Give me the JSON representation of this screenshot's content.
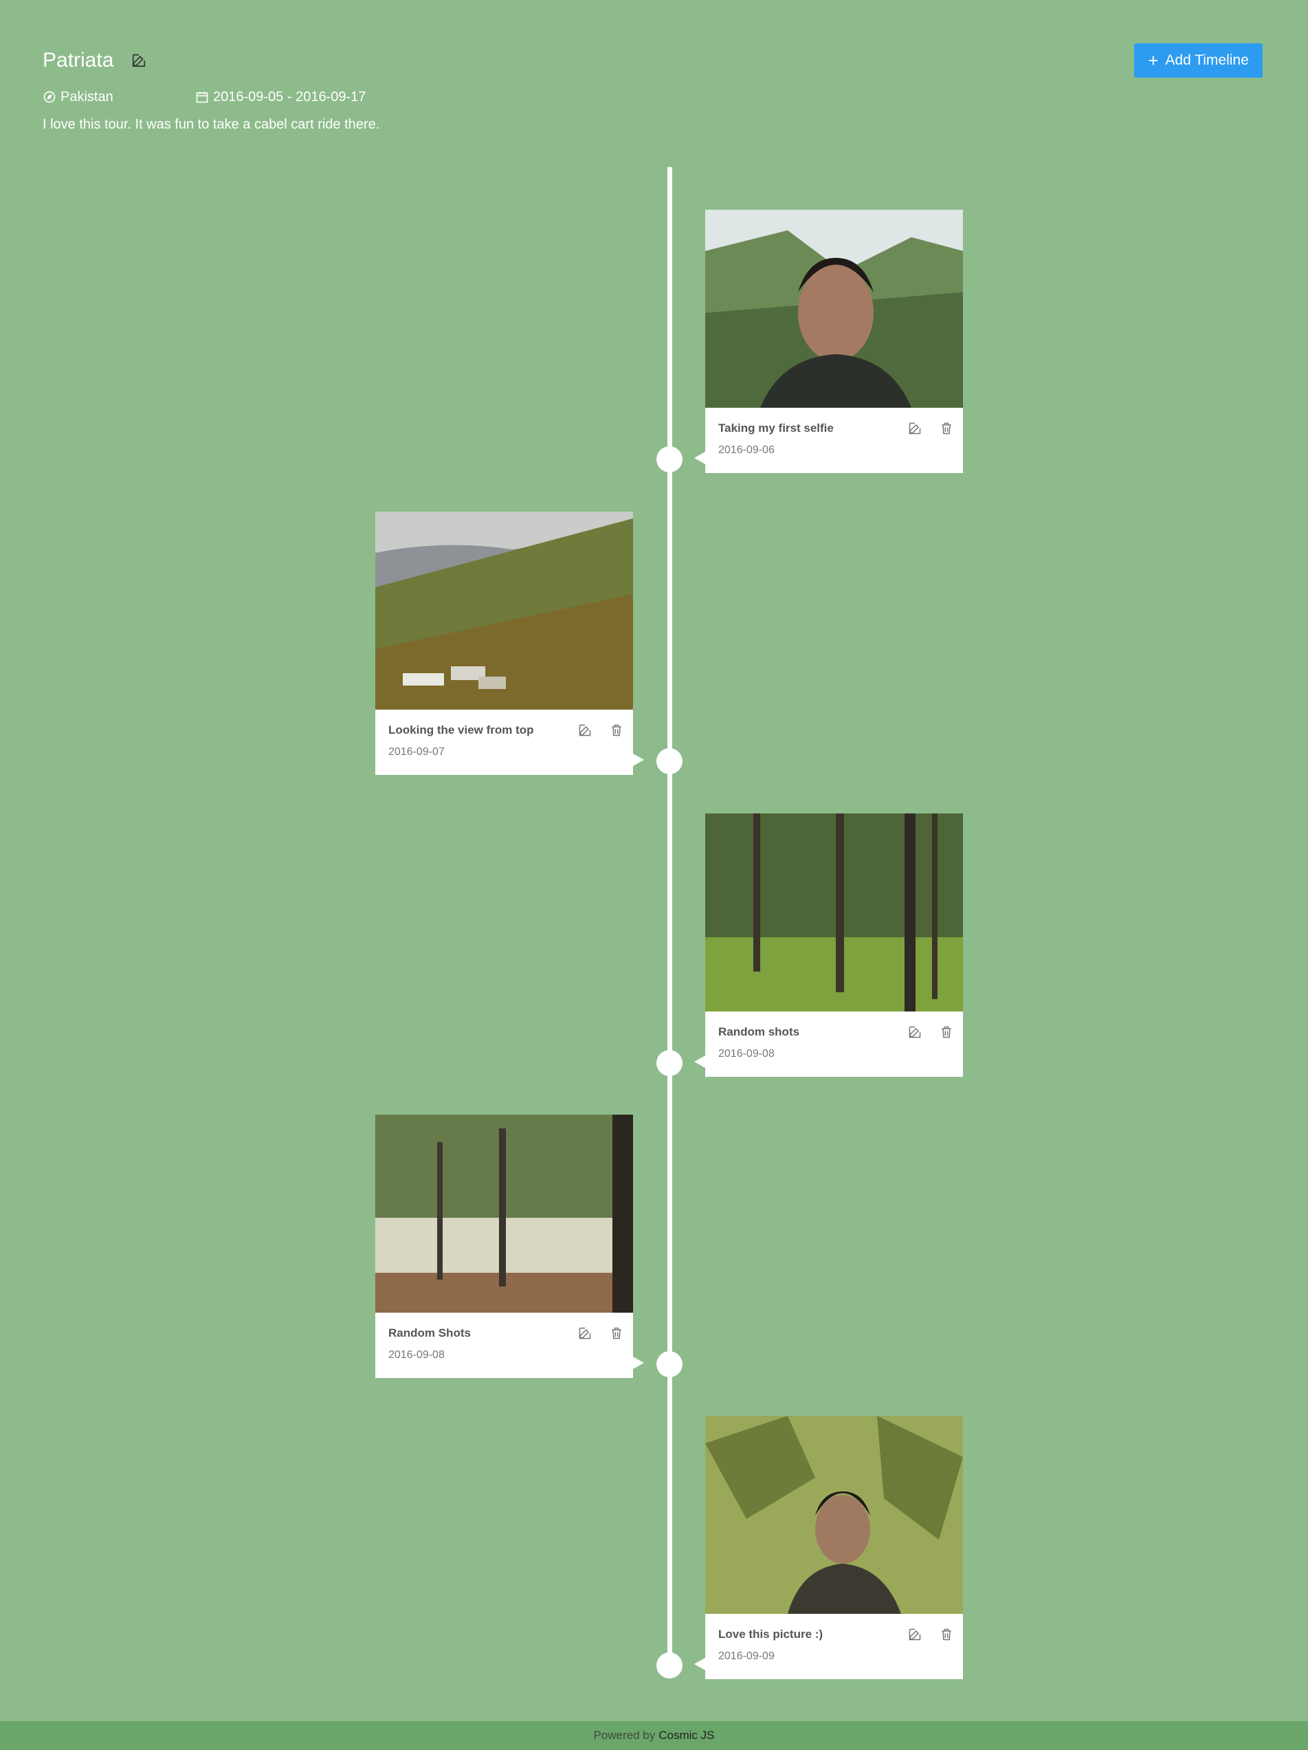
{
  "trip": {
    "title": "Patriata",
    "location": "Pakistan",
    "dates": "2016-09-05 - 2016-09-17",
    "description": "I love this tour. It was fun to take a cabel cart ride there."
  },
  "toolbar": {
    "add_timeline_label": "Add Timeline"
  },
  "entries": [
    {
      "title": "Taking my first selfie",
      "date": "2016-09-06",
      "side": "right",
      "photo": "selfie-mountains"
    },
    {
      "title": "Looking the view from top",
      "date": "2016-09-07",
      "side": "left",
      "photo": "hillside-view"
    },
    {
      "title": "Random shots",
      "date": "2016-09-08",
      "side": "right",
      "photo": "pine-forest"
    },
    {
      "title": "Random Shots",
      "date": "2016-09-08",
      "side": "left",
      "photo": "forest-slope"
    },
    {
      "title": "Love this picture :)",
      "date": "2016-09-09",
      "side": "right",
      "photo": "portrait-pines"
    }
  ],
  "footer": {
    "powered_by": "Powered by",
    "brand": "Cosmic JS"
  },
  "colors": {
    "background": "#8dbb8b",
    "accent": "#2d9bf0",
    "footer": "#6aa56a"
  }
}
